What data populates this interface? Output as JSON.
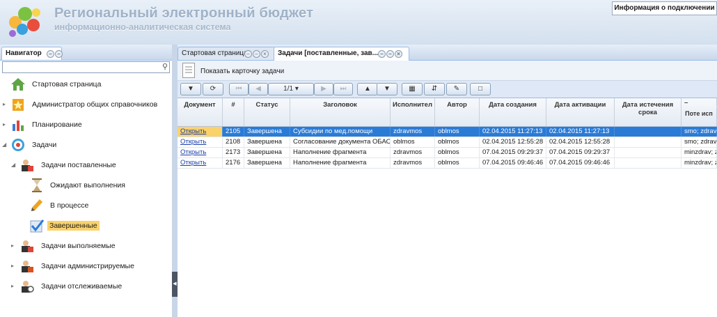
{
  "header": {
    "title": "Региональный электронный бюджет",
    "subtitle": "информационно-аналитическая система",
    "connection_info": "Информация о подключении"
  },
  "navigator": {
    "title": "Навигатор",
    "search_placeholder": "",
    "tree": [
      {
        "label": "Стартовая страница",
        "icon": "home-icon"
      },
      {
        "label": "Администратор общих справочников",
        "icon": "star-book-icon"
      },
      {
        "label": "Планирование",
        "icon": "chart-icon"
      },
      {
        "label": "Задачи",
        "icon": "target-icon"
      },
      {
        "label": "Задачи поставленные",
        "icon": "user-tasks-icon"
      },
      {
        "label": "Ожидают выполнения",
        "icon": "hourglass-icon"
      },
      {
        "label": "В процессе",
        "icon": "pencil-icon"
      },
      {
        "label": "Завершенные",
        "icon": "check-icon"
      },
      {
        "label": "Задачи выполняемые",
        "icon": "user-tasks-icon"
      },
      {
        "label": "Задачи администрируемые",
        "icon": "user-admin-icon"
      },
      {
        "label": "Задачи отслеживаемые",
        "icon": "user-watch-icon"
      }
    ]
  },
  "tabs": {
    "start": "Стартовая страница",
    "tasks": "Задачи [поставленные, зав..."
  },
  "toolbar": {
    "show_card": "Показать карточку задачи",
    "page": "1/1"
  },
  "grid": {
    "columns": [
      "Документ",
      "#",
      "Статус",
      "Заголовок",
      "Исполнител",
      "Автор",
      "Дата создания",
      "Дата активации",
      "Дата истечения срока",
      "–",
      "Поте исп"
    ],
    "rows": [
      {
        "doc": "Открыть",
        "id": "2105",
        "status": "Завершена",
        "title": "Субсидии по мед.помощи",
        "executor": "zdravmos",
        "author": "oblmos",
        "created": "02.04.2015 11:27:13",
        "activated": "02.04.2015 11:27:13",
        "expires": "",
        "extra": "smo; zdravm"
      },
      {
        "doc": "Открыть",
        "id": "2108",
        "status": "Завершена",
        "title": "Согласование документа ОБАС",
        "executor": "oblmos",
        "author": "oblmos",
        "created": "02.04.2015 12:55:28",
        "activated": "02.04.2015 12:55:28",
        "expires": "",
        "extra": "smo; zdravm"
      },
      {
        "doc": "Открыть",
        "id": "2173",
        "status": "Завершена",
        "title": "Наполнение фрагмента",
        "executor": "zdravmos",
        "author": "oblmos",
        "created": "07.04.2015 09:29:37",
        "activated": "07.04.2015 09:29:37",
        "expires": "",
        "extra": "minzdrav; zd"
      },
      {
        "doc": "Открыть",
        "id": "2176",
        "status": "Завершена",
        "title": "Наполнение фрагмента",
        "executor": "zdravmos",
        "author": "oblmos",
        "created": "07.04.2015 09:46:46",
        "activated": "07.04.2015 09:46:46",
        "expires": "",
        "extra": "minzdrav; zd"
      }
    ]
  },
  "colors": {
    "selection": "#2a7bd6",
    "highlight": "#fbd26a",
    "panel_border": "#99bbe8"
  }
}
